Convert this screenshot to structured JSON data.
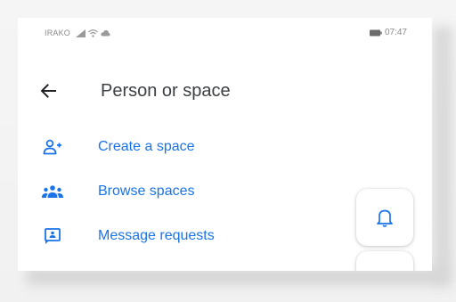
{
  "status_bar": {
    "carrier": "IRAKO",
    "time": "07:47"
  },
  "app_bar": {
    "title": "Person or space"
  },
  "menu": {
    "items": [
      {
        "label": "Create a space",
        "icon": "person-add-icon"
      },
      {
        "label": "Browse spaces",
        "icon": "group-icon"
      },
      {
        "label": "Message requests",
        "icon": "message-request-icon"
      }
    ]
  },
  "colors": {
    "accent": "#1a73e8",
    "title_text": "#3c4043",
    "status_text": "#8a8a8a"
  },
  "icons": {
    "back": "arrow-left-icon",
    "bell": "bell-icon"
  }
}
